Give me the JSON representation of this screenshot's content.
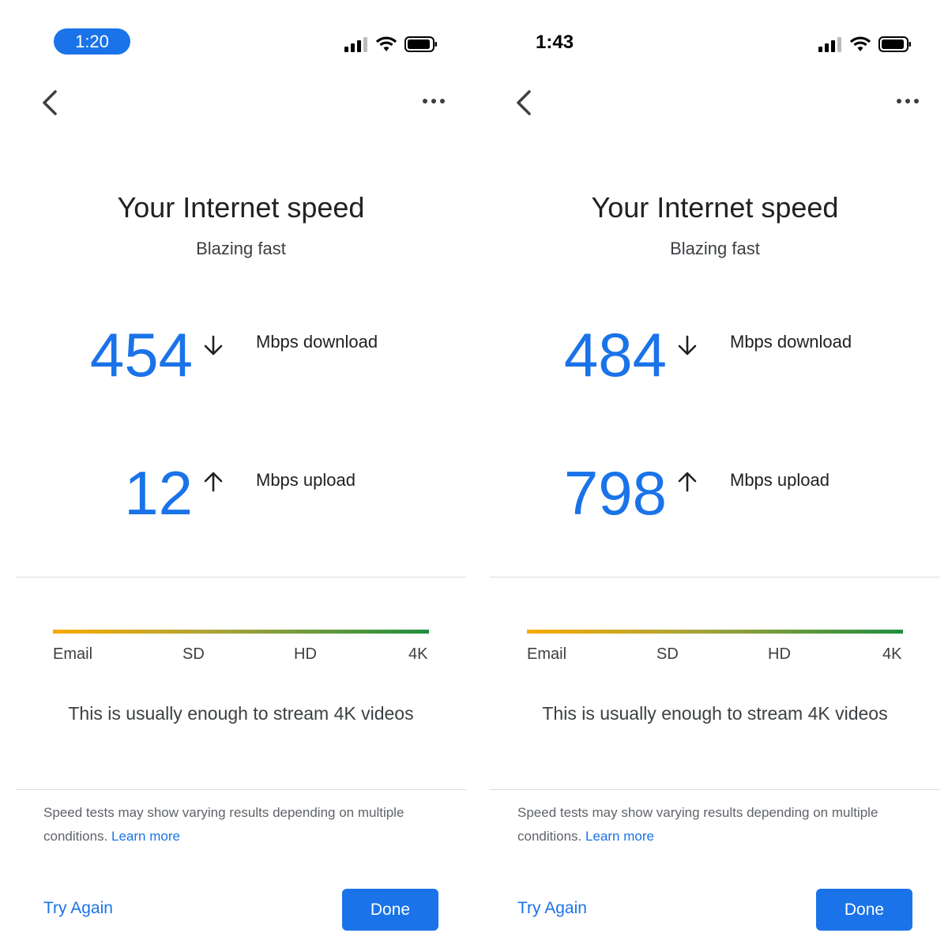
{
  "screens": [
    {
      "status_time": "1:20",
      "title": "Your Internet speed",
      "subtitle": "Blazing fast",
      "download_value": "454",
      "download_label": "Mbps download",
      "upload_value": "12",
      "upload_label": "Mbps upload",
      "scale_labels": [
        "Email",
        "SD",
        "HD",
        "4K"
      ],
      "note": "This is usually enough to stream 4K videos",
      "disclaimer": "Speed tests may show varying results depending on multiple conditions.",
      "learn_more": "Learn more",
      "try_again": "Try Again",
      "done": "Done"
    },
    {
      "status_time": "1:43",
      "title": "Your Internet speed",
      "subtitle": "Blazing fast",
      "download_value": "484",
      "download_label": "Mbps download",
      "upload_value": "798",
      "upload_label": "Mbps upload",
      "scale_labels": [
        "Email",
        "SD",
        "HD",
        "4K"
      ],
      "note": "This is usually enough to stream 4K videos",
      "disclaimer": "Speed tests may show varying results depending on multiple conditions.",
      "learn_more": "Learn more",
      "try_again": "Try Again",
      "done": "Done"
    }
  ],
  "colors": {
    "accent": "#1a73e8",
    "scale_start": "#f9ab00",
    "scale_end": "#1e8e3e"
  },
  "icons": [
    "cellular-signal-icon",
    "wifi-icon",
    "battery-icon",
    "back-chevron-icon",
    "more-horizontal-icon",
    "arrow-down-icon",
    "arrow-up-icon"
  ]
}
